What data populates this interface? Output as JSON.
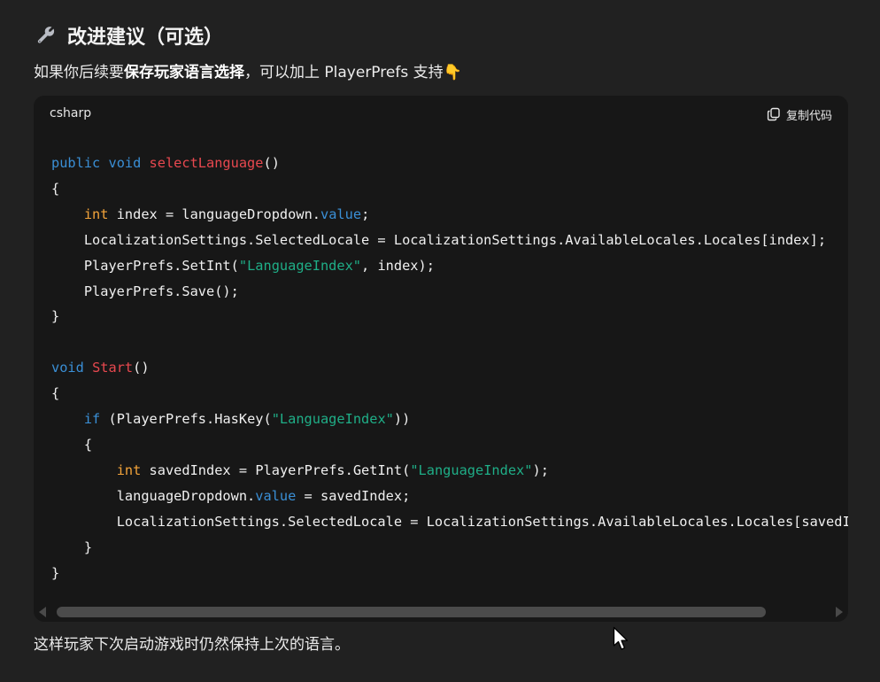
{
  "heading": {
    "emoji_icon": "wrench-icon",
    "title": "改进建议（可选）"
  },
  "intro": {
    "prefix": "如果你后续要",
    "bold": "保存玩家语言选择",
    "suffix": "，可以加上 PlayerPrefs 支持",
    "emoji": "👇"
  },
  "code_block": {
    "language": "csharp",
    "copy_label": "复制代码",
    "lines": [
      "public void selectLanguage()",
      "{",
      "    int index = languageDropdown.value;",
      "    LocalizationSettings.SelectedLocale = LocalizationSettings.AvailableLocales.Locales[index];",
      "    PlayerPrefs.SetInt(\"LanguageIndex\", index);",
      "    PlayerPrefs.Save();",
      "}",
      "",
      "void Start()",
      "{",
      "    if (PlayerPrefs.HasKey(\"LanguageIndex\"))",
      "    {",
      "        int savedIndex = PlayerPrefs.GetInt(\"LanguageIndex\");",
      "        languageDropdown.value = savedIndex;",
      "        LocalizationSettings.SelectedLocale = LocalizationSettings.AvailableLocales.Locales[savedI",
      "    }",
      "}"
    ]
  },
  "outro": "这样玩家下次启动游戏时仍然保持上次的语言。",
  "colors": {
    "background": "#212121",
    "code_background": "#171717",
    "keyword": "#3a8fd6",
    "function": "#e8484f",
    "type": "#f2a33a",
    "string": "#1fae87"
  }
}
